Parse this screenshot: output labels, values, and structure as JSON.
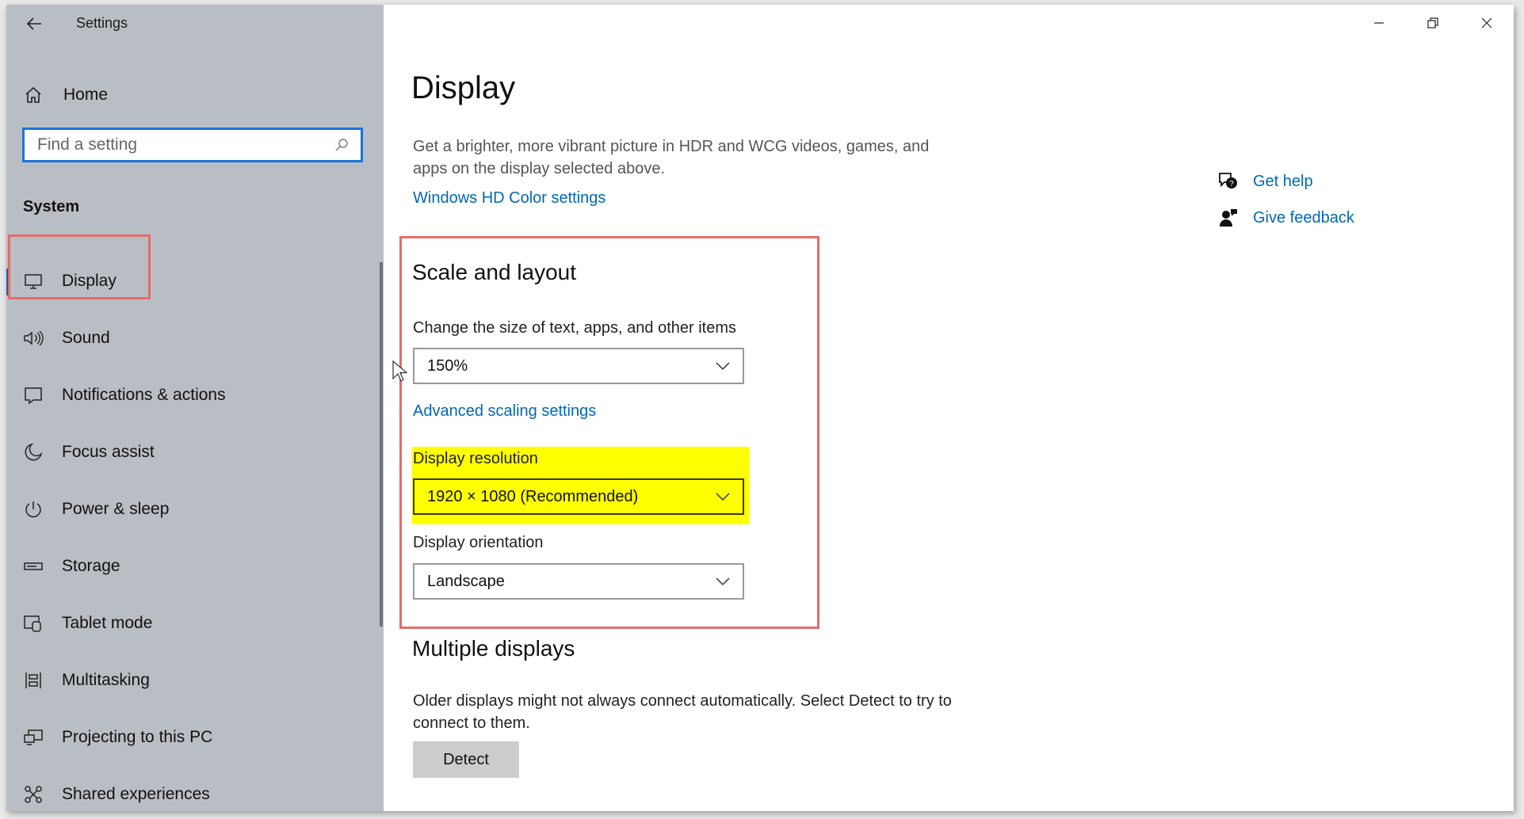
{
  "window": {
    "title": "Settings"
  },
  "sidebar": {
    "home_label": "Home",
    "search": {
      "placeholder": "Find a setting"
    },
    "section_label": "System",
    "items": [
      {
        "label": "Display",
        "icon": "monitor-icon",
        "active": true
      },
      {
        "label": "Sound",
        "icon": "speaker-icon",
        "active": false
      },
      {
        "label": "Notifications & actions",
        "icon": "notification-icon",
        "active": false
      },
      {
        "label": "Focus assist",
        "icon": "moon-icon",
        "active": false
      },
      {
        "label": "Power & sleep",
        "icon": "power-icon",
        "active": false
      },
      {
        "label": "Storage",
        "icon": "storage-icon",
        "active": false
      },
      {
        "label": "Tablet mode",
        "icon": "tablet-mode-icon",
        "active": false
      },
      {
        "label": "Multitasking",
        "icon": "multitasking-icon",
        "active": false
      },
      {
        "label": "Projecting to this PC",
        "icon": "projecting-icon",
        "active": false
      },
      {
        "label": "Shared experiences",
        "icon": "shared-experiences-icon",
        "active": false
      }
    ]
  },
  "main": {
    "title": "Display",
    "hdr": {
      "description": "Get a brighter, more vibrant picture in HDR and WCG videos, games, and apps on the display selected above.",
      "link": "Windows HD Color settings"
    },
    "scale_layout": {
      "title": "Scale and layout",
      "size_label": "Change the size of text, apps, and other items",
      "size_value": "150%",
      "advanced_link": "Advanced scaling settings",
      "resolution_label": "Display resolution",
      "resolution_value": "1920 × 1080 (Recommended)",
      "orientation_label": "Display orientation",
      "orientation_value": "Landscape"
    },
    "multiple_displays": {
      "title": "Multiple displays",
      "description": "Older displays might not always connect automatically. Select Detect to try to connect to them.",
      "detect_label": "Detect"
    }
  },
  "related": {
    "help_label": "Get help",
    "feedback_label": "Give feedback"
  },
  "colors": {
    "accent": "#0067b8",
    "sidebar_bg": "#b9bec4",
    "annotation_red": "#e26d6d",
    "highlight_yellow": "#ffff00"
  }
}
